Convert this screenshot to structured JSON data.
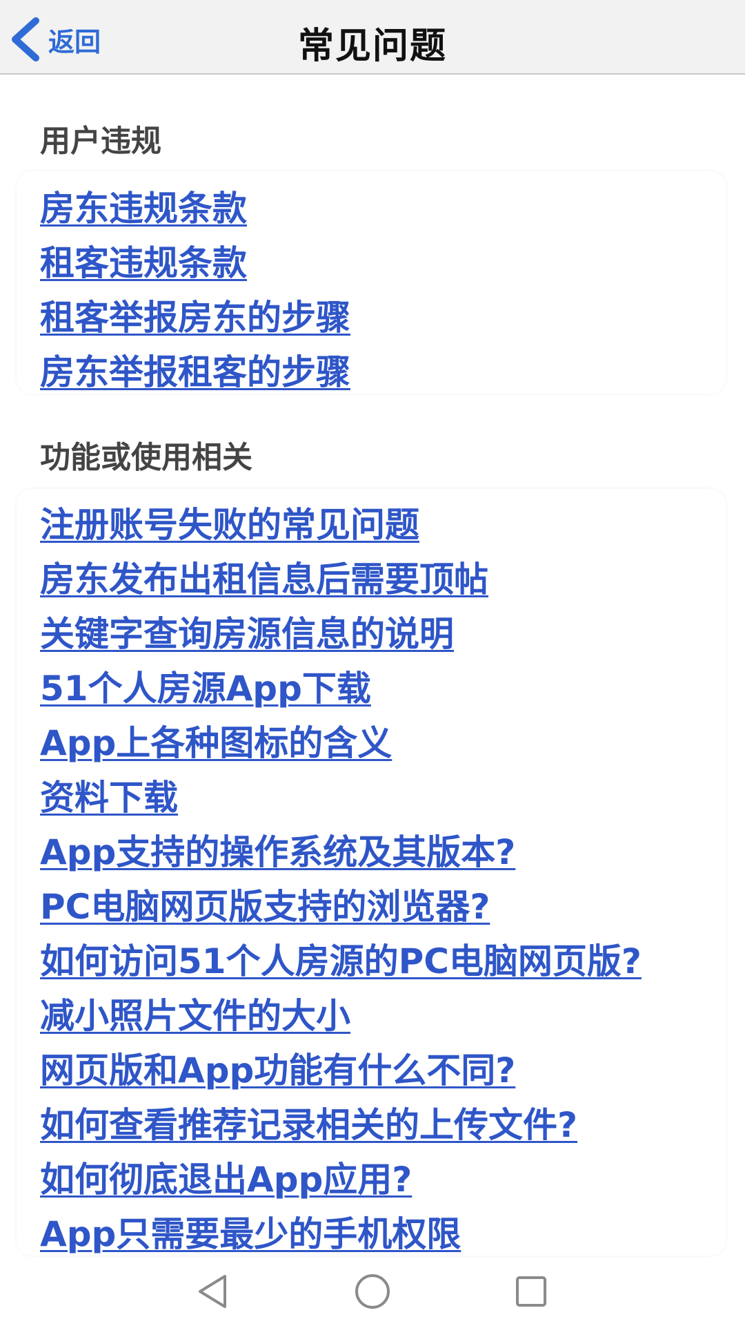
{
  "nav": {
    "back_label": "返回",
    "title": "常见问题"
  },
  "sections": [
    {
      "heading": "用户违规",
      "items": [
        "房东违规条款",
        "租客违规条款",
        "租客举报房东的步骤",
        "房东举报租客的步骤"
      ]
    },
    {
      "heading": "功能或使用相关",
      "items": [
        "注册账号失败的常见问题",
        "房东发布出租信息后需要顶帖",
        "关键字查询房源信息的说明",
        "51个人房源App下载",
        "App上各种图标的含义",
        "资料下载",
        "App支持的操作系统及其版本?",
        "PC电脑网页版支持的浏览器?",
        "如何访问51个人房源的PC电脑网页版?",
        "减小照片文件的大小",
        "网页版和App功能有什么不同?",
        "如何查看推荐记录相关的上传文件?",
        "如何彻底退出App应用?",
        "App只需要最少的手机权限"
      ]
    }
  ],
  "system_nav": {
    "icons": [
      "back-triangle-icon",
      "home-circle-icon",
      "recents-square-icon"
    ]
  },
  "colors": {
    "link": "#2f56c8",
    "back": "#2f6bd6",
    "heading": "#444444",
    "title": "#111111",
    "nav_bg": "#f2f2f2"
  }
}
